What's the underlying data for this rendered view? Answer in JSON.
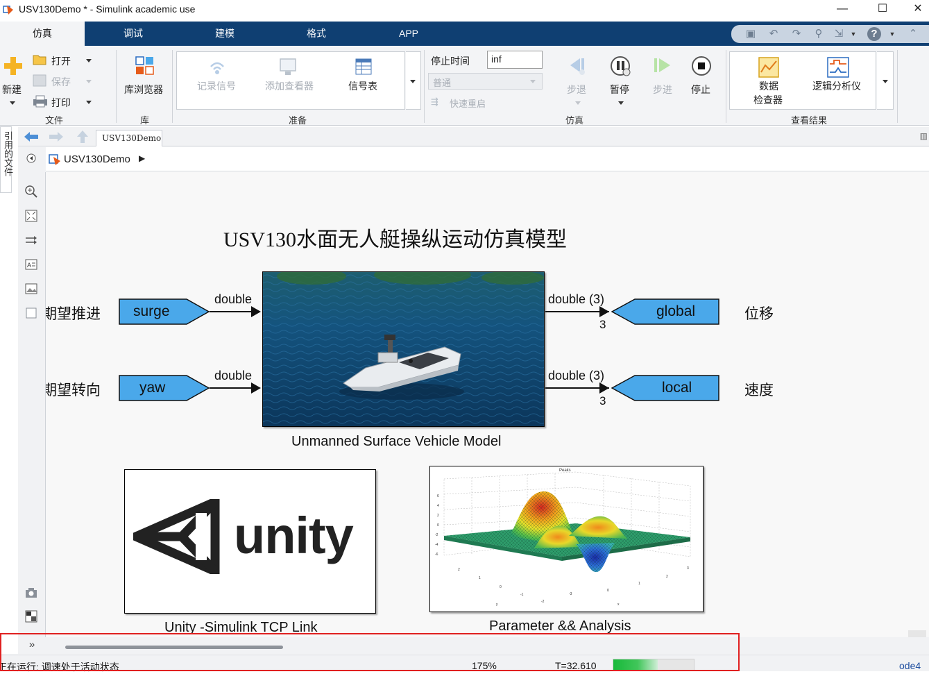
{
  "window": {
    "title": "USV130Demo * - Simulink academic use",
    "controls": [
      "—",
      "☐",
      "✕"
    ]
  },
  "ribbon_tabs": [
    {
      "label": "仿真",
      "active": true
    },
    {
      "label": "调试",
      "active": false
    },
    {
      "label": "建模",
      "active": false
    },
    {
      "label": "格式",
      "active": false
    },
    {
      "label": "APP",
      "active": false
    }
  ],
  "file_group": {
    "label": "文件",
    "new": "新建",
    "open": "打开",
    "save": "保存",
    "print": "打印"
  },
  "library_group": {
    "label": "库",
    "browser": "库浏览器"
  },
  "prepare_group": {
    "label": "准备",
    "log_signals": "记录信号",
    "add_viewer": "添加查看器",
    "signal_table": "信号表"
  },
  "simulate_group": {
    "label": "仿真",
    "stop_time_label": "停止时间",
    "stop_time_value": "inf",
    "mode_value": "普通",
    "fast_restart": "快速重启",
    "step_back": "步退",
    "pause": "暂停",
    "step_forward": "步进",
    "stop": "停止"
  },
  "results_group": {
    "label": "查看结果",
    "data_inspector": "数据\n检查器",
    "logic_analyzer": "逻辑分析仪"
  },
  "side_tab": "引用的文件",
  "editor": {
    "tab": "USV130Demo",
    "breadcrumb": "USV130Demo"
  },
  "canvas": {
    "title": "USV130水面无人艇操纵运动仿真模型",
    "inports": [
      {
        "name": "surge",
        "desc": "期望推进",
        "signal": "double"
      },
      {
        "name": "yaw",
        "desc": "期望转向",
        "signal": "double"
      }
    ],
    "outports": [
      {
        "name": "global",
        "desc": "位移",
        "signal": "double (3)",
        "width": "3"
      },
      {
        "name": "local",
        "desc": "速度",
        "signal": "double (3)",
        "width": "3"
      }
    ],
    "vehicle_caption": "Unmanned Surface Vehicle Model",
    "unity_word": "unity",
    "unity_caption": "Unity -Simulink TCP Link",
    "analysis_caption": "Parameter && Analysis",
    "plot_title": "Peaks"
  },
  "status": {
    "message": "正在运行: 调速处于活动状态",
    "zoom": "175%",
    "time": "T=32.610",
    "progress_pct": 55,
    "solver": "ode4"
  },
  "colors": {
    "tab_bar": "#0f3f72",
    "port_fill": "#4aa8ea",
    "highlight_border": "#e02020",
    "solver_text": "#1f4fa0"
  }
}
